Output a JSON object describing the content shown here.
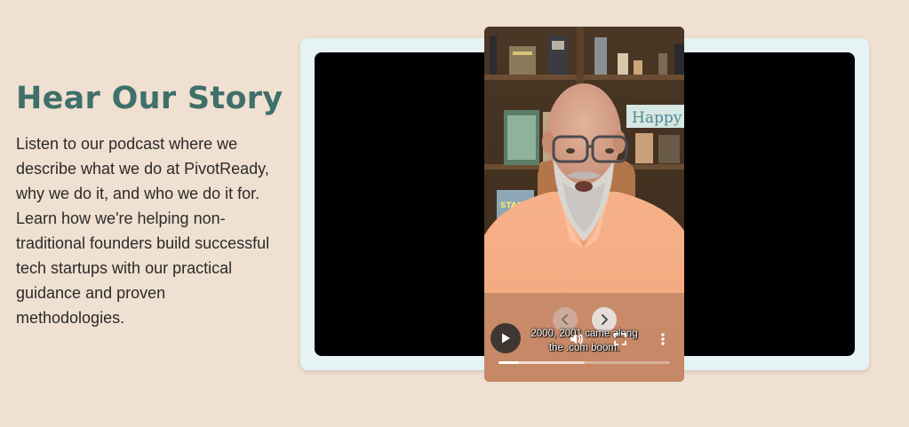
{
  "section": {
    "heading": "Hear Our Story",
    "description": "Listen to our podcast where we describe what we do at PivotReady, why we do it, and who we do it for. Learn how we're helping non-traditional founders build successful tech startups with our practical guidance and proven methodologies."
  },
  "colors": {
    "background": "#efe0d2",
    "heading": "#3f7069",
    "frame": "#e6f3f4"
  },
  "player": {
    "caption_line1": "2000, 2001 came along",
    "caption_line2": "the .com boom.",
    "progress_fraction": 0.12,
    "buffered_fraction": 0.5,
    "icons": {
      "prev": "chevron-left-icon",
      "next": "chevron-right-icon",
      "play": "play-icon",
      "volume": "volume-icon",
      "fullscreen": "fullscreen-icon",
      "more": "more-vertical-icon"
    },
    "shelf_sign_text": "Happy!",
    "shelf_book_text": "STAR WARS"
  }
}
